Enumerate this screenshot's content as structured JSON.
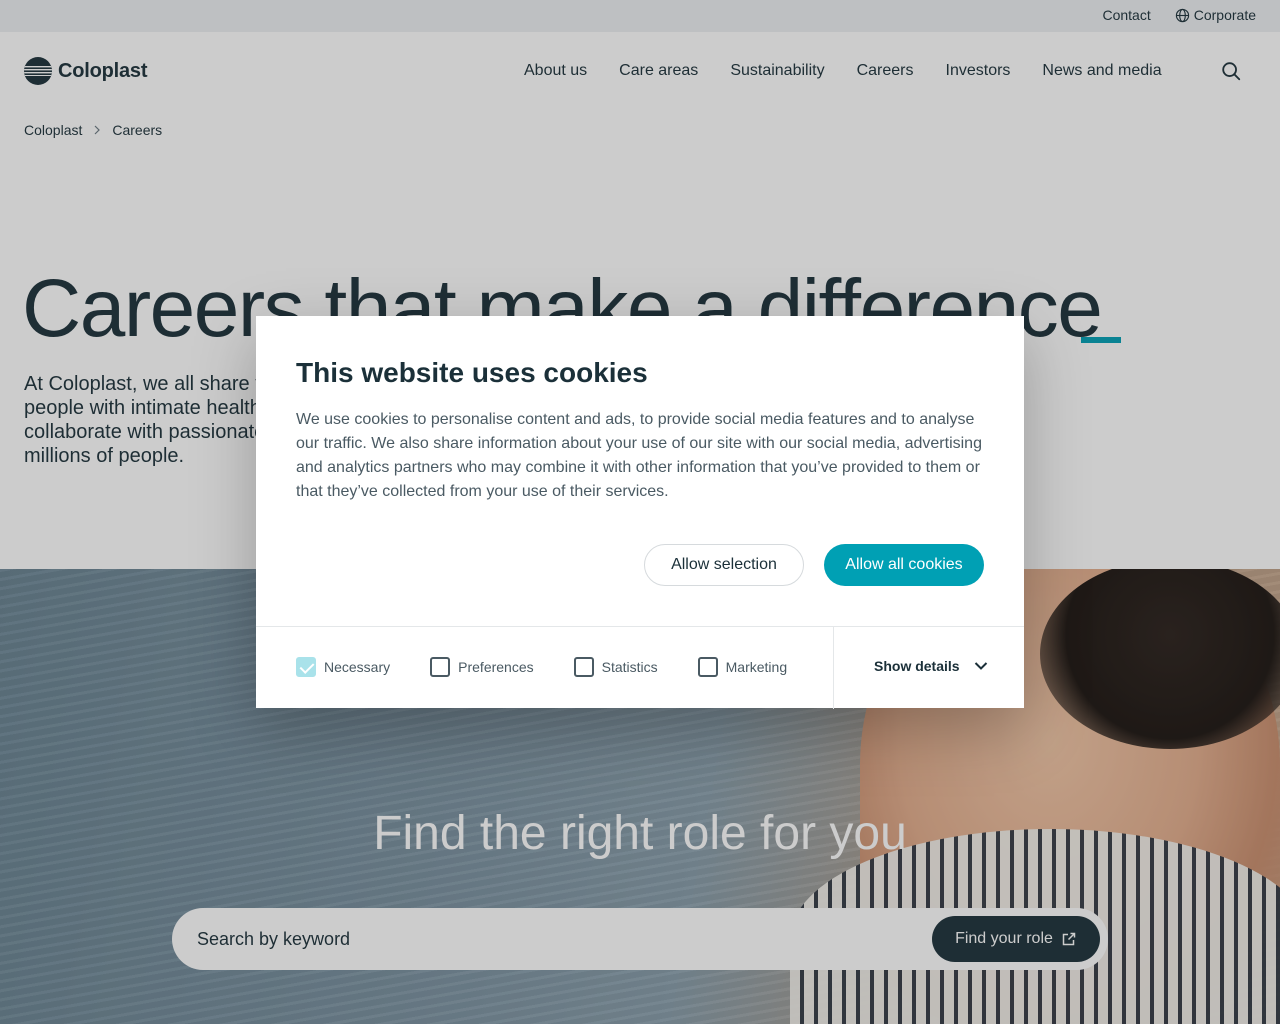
{
  "topbar": {
    "contact_label": "Contact",
    "corporate_label": "Corporate",
    "globe_icon": "globe-icon"
  },
  "header": {
    "logo_text": "Coloplast",
    "nav": [
      {
        "label": "About us"
      },
      {
        "label": "Care areas"
      },
      {
        "label": "Sustainability"
      },
      {
        "label": "Careers"
      },
      {
        "label": "Investors"
      },
      {
        "label": "News and media"
      }
    ],
    "search_icon": "search-icon"
  },
  "breadcrumb": {
    "items": [
      "Coloplast",
      "Careers"
    ]
  },
  "hero": {
    "title": "Careers that make a difference",
    "text": "At Coloplast, we all share the same purpose: making life easier for people with intimate healthcare needs. Join us and grow your career, collaborate with passionate colleagues and make a difference for millions of people."
  },
  "careers_search": {
    "title": "Find the right role for you",
    "placeholder": "Search by keyword",
    "button_label": "Find your role",
    "button_icon": "external-link-icon"
  },
  "cookie_dialog": {
    "title": "This website uses cookies",
    "text": "We use cookies to personalise content and ads, to provide social media features and to analyse our traffic. We also share information about your use of our site with our social media, advertising and analytics partners who may combine it with other information that you’ve provided to them or that they’ve collected from your use of their services.",
    "allow_selection_label": "Allow selection",
    "allow_all_label": "Allow all cookies",
    "options": [
      {
        "label": "Necessary",
        "checked": true
      },
      {
        "label": "Preferences",
        "checked": false
      },
      {
        "label": "Statistics",
        "checked": false
      },
      {
        "label": "Marketing",
        "checked": false
      }
    ],
    "show_details_label": "Show details"
  },
  "colors": {
    "brand_dark": "#1b3039",
    "accent_teal": "#00a0b4",
    "checkbox_checked": "#a9e2ea"
  }
}
